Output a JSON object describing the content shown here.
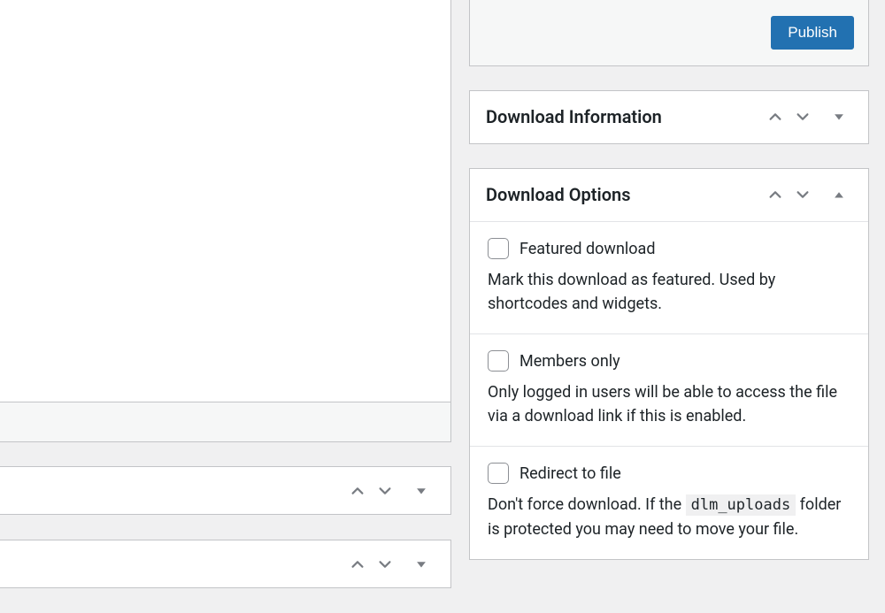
{
  "publish": {
    "button_label": "Publish"
  },
  "download_info": {
    "title": "Download Information"
  },
  "download_options": {
    "title": "Download Options",
    "items": [
      {
        "label": "Featured download",
        "desc_pre": "Mark this download as featured. Used by shortcodes and widgets.",
        "code": "",
        "desc_post": ""
      },
      {
        "label": "Members only",
        "desc_pre": "Only logged in users will be able to access the file via a download link if this is enabled.",
        "code": "",
        "desc_post": ""
      },
      {
        "label": "Redirect to file",
        "desc_pre": "Don't force download. If the ",
        "code": "dlm_uploads",
        "desc_post": " folder is protected you may need to move your file."
      }
    ]
  }
}
